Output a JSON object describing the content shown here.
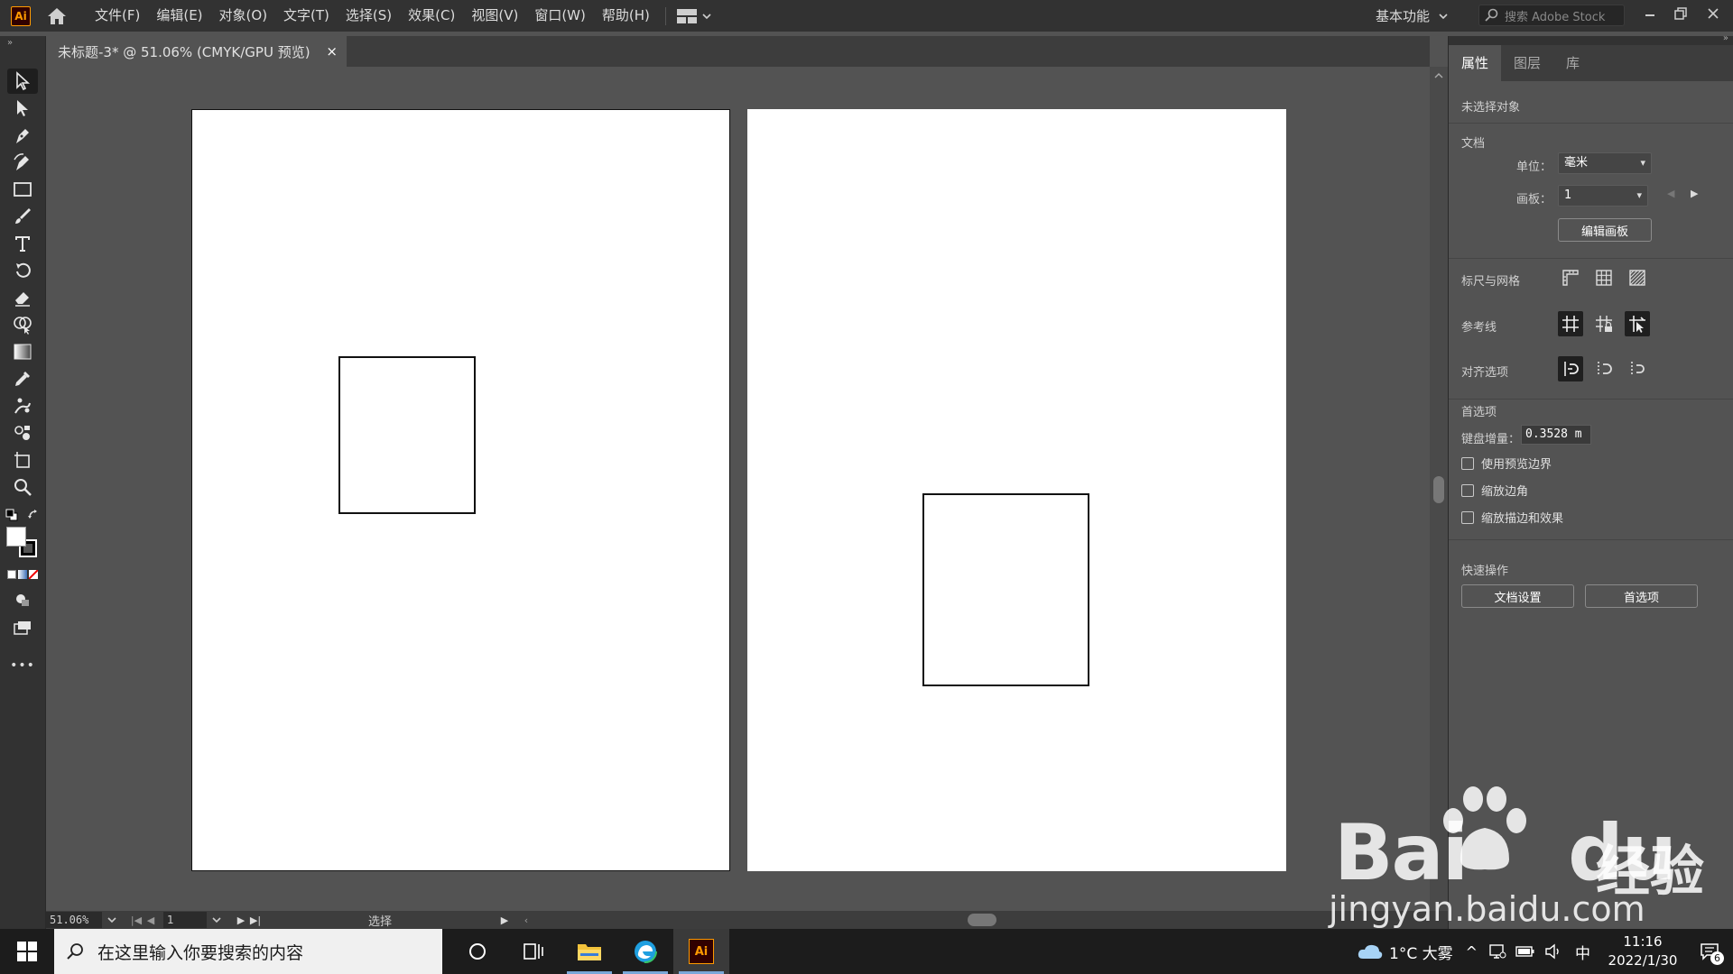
{
  "app": {
    "logo": "Ai",
    "menus": [
      "文件(F)",
      "编辑(E)",
      "对象(O)",
      "文字(T)",
      "选择(S)",
      "效果(C)",
      "视图(V)",
      "窗口(W)",
      "帮助(H)"
    ],
    "workspace": "基本功能",
    "stock_search_placeholder": "搜索 Adobe Stock"
  },
  "document_tab": {
    "title": "未标题-3* @ 51.06% (CMYK/GPU 预览)",
    "close": "×"
  },
  "toolbar": {
    "tools": [
      "selection",
      "direct-selection",
      "pen",
      "curvature",
      "rectangle",
      "paintbrush",
      "type",
      "rotate",
      "eraser",
      "shape-builder",
      "gradient",
      "eyedropper",
      "puppet-warp",
      "symbol-sprayer",
      "artboard",
      "zoom"
    ],
    "more": "•••"
  },
  "status_bar": {
    "zoom": "51.06%",
    "artboard_number": "1",
    "status_text": "选择"
  },
  "properties_panel": {
    "tabs": [
      "属性",
      "图层",
      "库"
    ],
    "active_tab": "属性",
    "no_selection": "未选择对象",
    "document_section": "文档",
    "unit_label": "单位：",
    "unit_value": "毫米",
    "artboard_label": "画板：",
    "artboard_value": "1",
    "edit_artboards": "编辑画板",
    "rulers_grids": "标尺与网格",
    "guides": "参考线",
    "snap_options": "对齐选项",
    "preferences_section": "首选项",
    "keyboard_increment_label": "键盘增量：",
    "keyboard_increment_value": "0.3528 m",
    "checkboxes": [
      {
        "label": "使用预览边界",
        "checked": false
      },
      {
        "label": "缩放边角",
        "checked": false
      },
      {
        "label": "缩放描边和效果",
        "checked": false
      }
    ],
    "quick_actions": "快速操作",
    "document_setup": "文档设置",
    "preferences_button": "首选项"
  },
  "watermark": {
    "brand": "Bai",
    "brand_suffix": "du",
    "cn": "经验",
    "url": "jingyan.baidu.com"
  },
  "taskbar": {
    "search_placeholder": "在这里输入你要搜索的内容",
    "weather": "1°C 大雾",
    "ime": "中",
    "time": "11:16",
    "date": "2022/1/30",
    "notification_count": "6"
  },
  "colors": {
    "accent_ai": "#ff9a00",
    "panel_bg": "#535353",
    "chrome_bg": "#323232"
  }
}
